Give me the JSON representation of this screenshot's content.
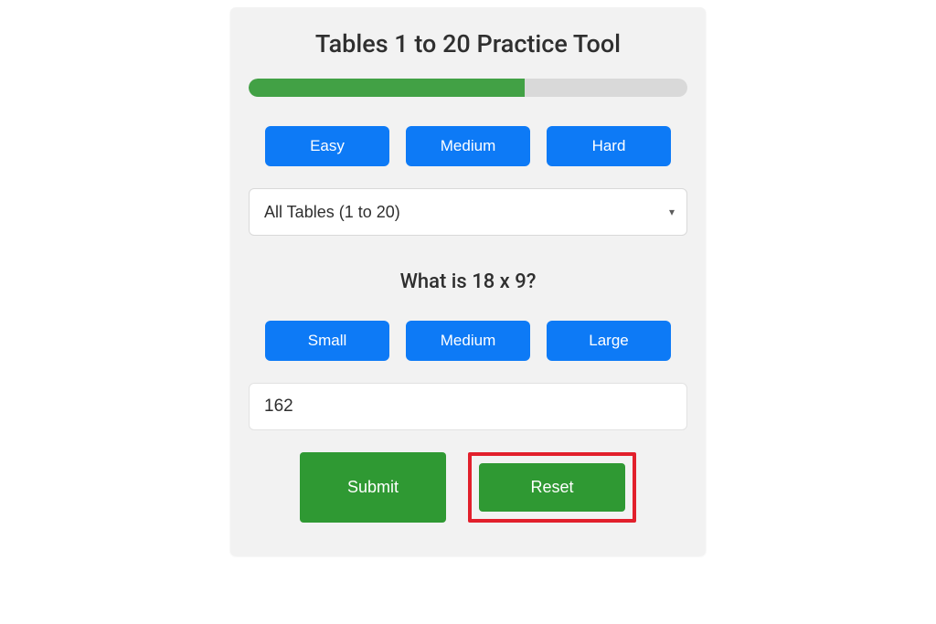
{
  "title": "Tables 1 to 20 Practice Tool",
  "progress": {
    "percent": 63
  },
  "difficulty": {
    "easy": "Easy",
    "medium": "Medium",
    "hard": "Hard"
  },
  "table_select": {
    "selected": "All Tables (1 to 20)"
  },
  "question": "What is 18 x 9?",
  "size": {
    "small": "Small",
    "medium": "Medium",
    "large": "Large"
  },
  "answer": {
    "value": "162"
  },
  "actions": {
    "submit": "Submit",
    "reset": "Reset"
  }
}
